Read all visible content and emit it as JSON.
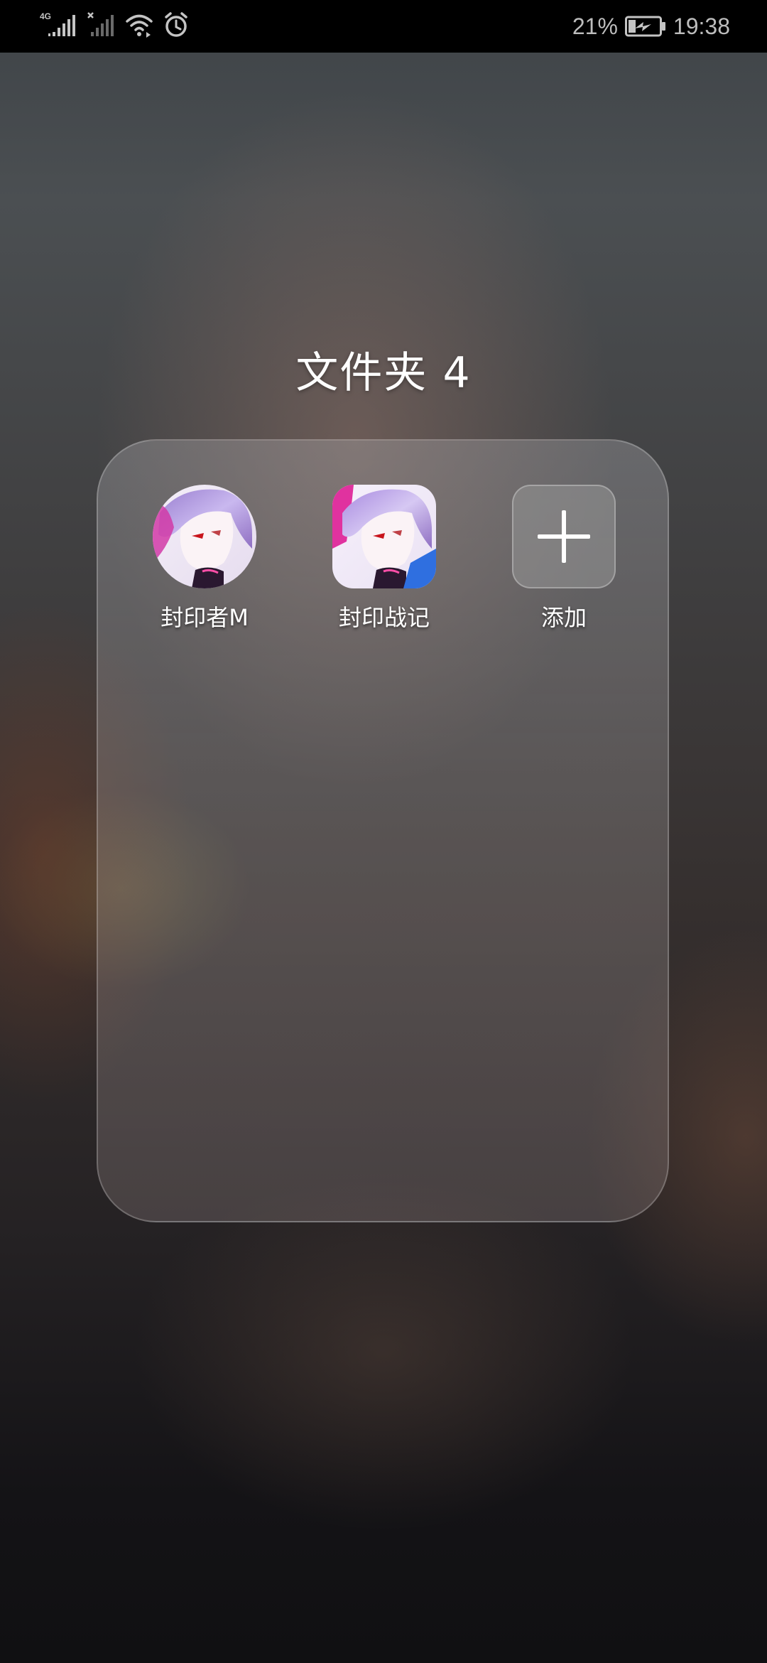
{
  "status_bar": {
    "network_type": "4G",
    "battery_percent": "21%",
    "time": "19:38",
    "icons": [
      "signal-4g-icon",
      "signal-sim2-no-service-icon",
      "wifi-icon",
      "alarm-icon",
      "battery-charging-icon"
    ]
  },
  "folder": {
    "title": "文件夹 4",
    "apps": [
      {
        "label": "封印者M",
        "icon": "anime-character-app-icon-round"
      },
      {
        "label": "封印战记",
        "icon": "anime-character-app-icon-square"
      },
      {
        "label": "添加",
        "icon": "plus-icon"
      }
    ]
  },
  "colors": {
    "status_bar_bg": "#000000",
    "status_text": "#bdbdbd",
    "label_text": "#ffffff"
  }
}
